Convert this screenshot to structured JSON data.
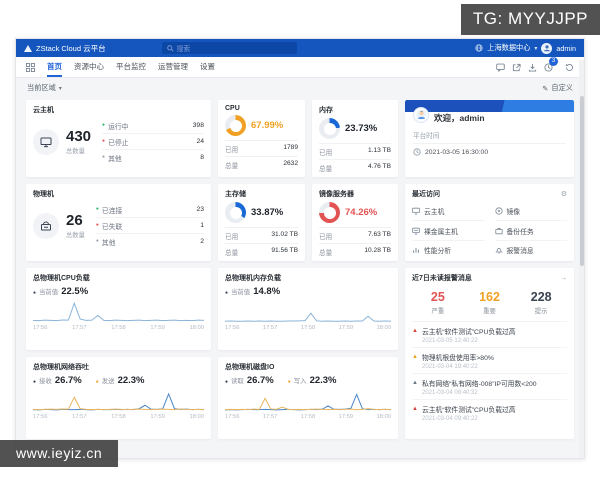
{
  "watermark_top": "TG: MYYJJPP",
  "watermark_bottom": "www.ieyiz.cn",
  "topbar": {
    "brand": "ZStack Cloud 云平台",
    "search_placeholder": "搜索",
    "datacenter": "上海数据中心",
    "user": "admin"
  },
  "nav": {
    "tabs": [
      {
        "label": "首页"
      },
      {
        "label": "资源中心"
      },
      {
        "label": "平台监控"
      },
      {
        "label": "运营管理"
      },
      {
        "label": "设置"
      }
    ],
    "badge": "3"
  },
  "subheader": {
    "region": "当前区域",
    "customize": "自定义"
  },
  "vm": {
    "title": "云主机",
    "total": "430",
    "total_label": "总数量",
    "stats": [
      {
        "label": "运行中",
        "value": "398",
        "color": "#2fb56b"
      },
      {
        "label": "已停止",
        "value": "24",
        "color": "#e25454"
      },
      {
        "label": "其他",
        "value": "8",
        "color": "#9aa2ad"
      }
    ]
  },
  "cpu": {
    "title": "CPU",
    "percent": 67.99,
    "display": "67.99%",
    "color": "#f0a125",
    "rows": [
      {
        "label": "已用",
        "value": "1789"
      },
      {
        "label": "总量",
        "value": "2632"
      }
    ]
  },
  "memory": {
    "title": "内存",
    "percent": 23.73,
    "display": "23.73%",
    "color": "#1968d6",
    "rows": [
      {
        "label": "已用",
        "value": "1.13 TB"
      },
      {
        "label": "总量",
        "value": "4.76 TB"
      }
    ]
  },
  "welcome": {
    "greeting": "欢迎，admin",
    "time_label": "平台时间",
    "time": "2021-03-05 16:30:00"
  },
  "host": {
    "title": "物理机",
    "total": "26",
    "total_label": "总数量",
    "stats": [
      {
        "label": "已连接",
        "value": "23",
        "color": "#2fb56b"
      },
      {
        "label": "已失联",
        "value": "1",
        "color": "#e25454"
      },
      {
        "label": "其他",
        "value": "2",
        "color": "#9aa2ad"
      }
    ]
  },
  "storage": {
    "title": "主存储",
    "percent": 33.87,
    "display": "33.87%",
    "color": "#1968d6",
    "rows": [
      {
        "label": "已用",
        "value": "31.02 TB"
      },
      {
        "label": "总量",
        "value": "91.56 TB"
      }
    ]
  },
  "imageserver": {
    "title": "镜像服务器",
    "percent": 74.26,
    "display": "74.26%",
    "color": "#e25454",
    "rows": [
      {
        "label": "已用",
        "value": "7.63 TB"
      },
      {
        "label": "总量",
        "value": "10.28 TB"
      }
    ]
  },
  "recent": {
    "title": "最近访问",
    "items": [
      {
        "label": "云主机"
      },
      {
        "label": "镜像"
      },
      {
        "label": "裸金属主机"
      },
      {
        "label": "备份任务"
      },
      {
        "label": "性能分析"
      },
      {
        "label": "报警消息"
      }
    ]
  },
  "alerts": {
    "title": "近7日未读报警消息",
    "summary": [
      {
        "value": "25",
        "label": "严重",
        "color": "#e25454"
      },
      {
        "value": "162",
        "label": "重要",
        "color": "#f0a125"
      },
      {
        "value": "228",
        "label": "提示",
        "color": "#3a4450"
      }
    ],
    "items": [
      {
        "severity": "critical",
        "color": "#d9453e",
        "text": "云主机“软件测试”CPU负载过高",
        "time": "2021-03-05 12:40:22"
      },
      {
        "severity": "major",
        "color": "#f0a125",
        "text": "物理机根盘使用率>80%",
        "time": "2021-03-04 19:40:22"
      },
      {
        "severity": "info",
        "color": "#6b7785",
        "text": "私有网络“私有网络-008”IP可用数<200",
        "time": "2021-03-04 08:40:32"
      },
      {
        "severity": "critical",
        "color": "#d9453e",
        "text": "云主机“软件测试”CPU负载过高",
        "time": "2021-03-04 09:40:22"
      }
    ]
  },
  "chart_data": [
    {
      "type": "line",
      "title": "总物理机CPU负载",
      "legend": [
        {
          "label": "当前值",
          "value": "22.5%",
          "color": "#2f3d52"
        }
      ],
      "x_ticks": [
        "17:56",
        "17:57",
        "17:58",
        "17:59",
        "18:00"
      ],
      "ylim": [
        0,
        100
      ],
      "grid": false,
      "legend_position": "top",
      "series": [
        {
          "name": "当前值",
          "color": "#8ab4da",
          "values": [
            9,
            8,
            10,
            9,
            8,
            11,
            10,
            88,
            15,
            9,
            10,
            32,
            9,
            8,
            10,
            9,
            8,
            9,
            10,
            8,
            9,
            10,
            8,
            9,
            10,
            8,
            9,
            8,
            10,
            9
          ]
        }
      ]
    },
    {
      "type": "line",
      "title": "总物理机内存负载",
      "legend": [
        {
          "label": "当前值",
          "value": "14.8%",
          "color": "#2f3d52"
        }
      ],
      "x_ticks": [
        "17:56",
        "17:57",
        "17:58",
        "17:59",
        "18:00"
      ],
      "ylim": [
        0,
        100
      ],
      "grid": false,
      "legend_position": "top",
      "series": [
        {
          "name": "当前值",
          "color": "#8ab4da",
          "values": [
            5,
            6,
            5,
            5,
            6,
            5,
            6,
            5,
            6,
            5,
            5,
            6,
            6,
            7,
            8,
            42,
            7,
            5,
            6,
            5,
            5,
            6,
            5,
            6,
            6,
            28,
            6,
            5,
            6,
            5
          ]
        }
      ]
    },
    {
      "type": "line",
      "title": "总物理机网络吞吐",
      "legend": [
        {
          "label": "接收",
          "value": "26.7%",
          "color": "#2f3d52"
        },
        {
          "label": "发送",
          "value": "22.3%",
          "color": "#f0a125"
        }
      ],
      "x_ticks": [
        "17:56",
        "17:57",
        "17:58",
        "17:59",
        "18:00"
      ],
      "ylim": [
        0,
        100
      ],
      "grid": false,
      "legend_position": "top",
      "series": [
        {
          "name": "接收",
          "color": "#4a86c8",
          "values": [
            8,
            7,
            9,
            8,
            7,
            9,
            8,
            8,
            9,
            8,
            7,
            9,
            8,
            8,
            9,
            8,
            9,
            8,
            12,
            28,
            10,
            9,
            12,
            80,
            12,
            9,
            10,
            8,
            9,
            8
          ]
        },
        {
          "name": "发送",
          "color": "#e9b55c",
          "values": [
            9,
            8,
            9,
            10,
            9,
            11,
            10,
            65,
            12,
            9,
            8,
            9,
            8,
            9,
            10,
            9,
            8,
            9,
            10,
            9,
            8,
            9,
            10,
            9,
            8,
            11,
            9,
            8,
            9,
            8
          ]
        }
      ]
    },
    {
      "type": "line",
      "title": "总物理机磁盘IO",
      "legend": [
        {
          "label": "读取",
          "value": "26.7%",
          "color": "#2f3d52"
        },
        {
          "label": "写入",
          "value": "22.3%",
          "color": "#f0a125"
        }
      ],
      "x_ticks": [
        "17:56",
        "17:57",
        "17:58",
        "17:59",
        "18:00"
      ],
      "ylim": [
        0,
        100
      ],
      "grid": false,
      "legend_position": "top",
      "series": [
        {
          "name": "读取",
          "color": "#4a86c8",
          "values": [
            7,
            8,
            7,
            8,
            9,
            8,
            8,
            9,
            8,
            7,
            8,
            9,
            8,
            7,
            8,
            9,
            8,
            10,
            25,
            10,
            9,
            10,
            14,
            78,
            12,
            8,
            9,
            8,
            9,
            8
          ]
        },
        {
          "name": "写入",
          "color": "#e9b55c",
          "values": [
            8,
            9,
            8,
            9,
            8,
            10,
            9,
            60,
            11,
            9,
            20,
            9,
            8,
            9,
            8,
            9,
            10,
            9,
            8,
            9,
            8,
            9,
            10,
            8,
            9,
            12,
            9,
            8,
            9,
            8
          ]
        }
      ]
    }
  ]
}
